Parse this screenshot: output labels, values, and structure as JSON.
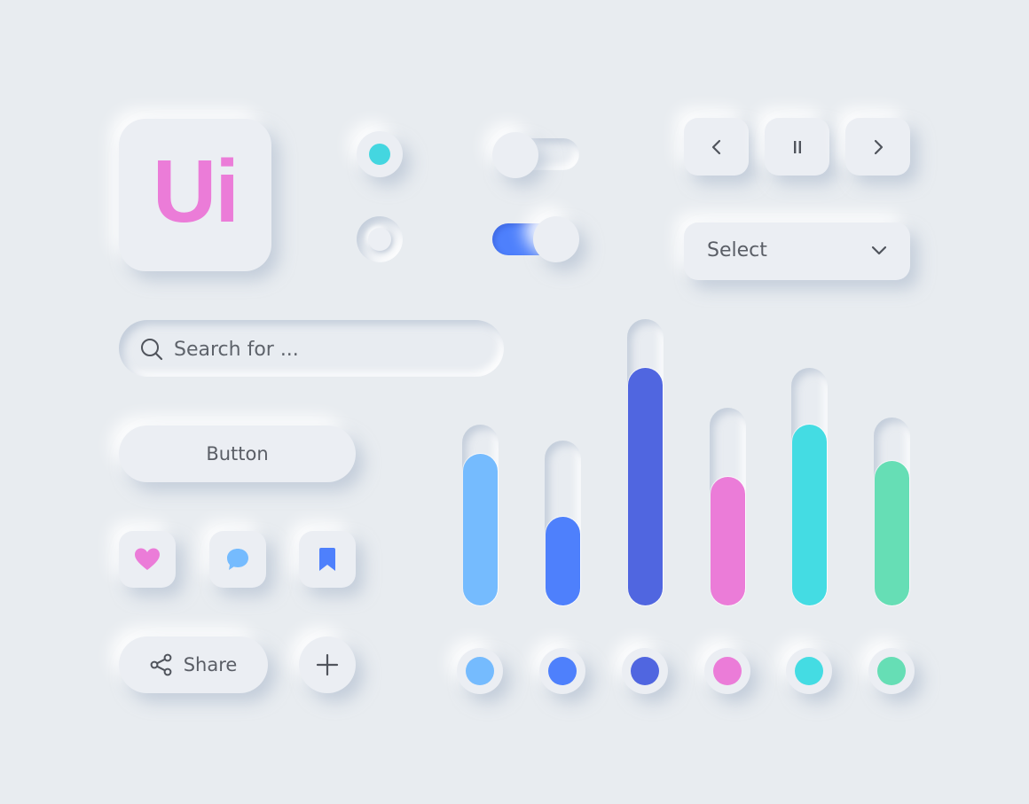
{
  "logo": {
    "text": "Ui",
    "color": "#EB7CD8"
  },
  "radios": [
    {
      "name": "radio-selected",
      "checked": true,
      "accent": "#44D6E0"
    },
    {
      "name": "radio-unselected",
      "checked": false
    }
  ],
  "toggles": [
    {
      "name": "toggle-off",
      "on": false
    },
    {
      "name": "toggle-on",
      "on": true,
      "accent": "#4E80FC"
    }
  ],
  "media": {
    "prev_icon": "chevron-left-icon",
    "pause_icon": "pause-icon",
    "next_icon": "chevron-right-icon"
  },
  "select": {
    "label": "Select",
    "icon": "chevron-down-icon"
  },
  "search": {
    "placeholder": "Search for ...",
    "value": "",
    "icon": "search-icon"
  },
  "button": {
    "label": "Button"
  },
  "icon_buttons": [
    {
      "name": "like",
      "icon": "heart-icon",
      "color": "#EB7CD8"
    },
    {
      "name": "comment",
      "icon": "chat-bubble-icon",
      "color": "#75BBFE"
    },
    {
      "name": "bookmark",
      "icon": "bookmark-icon",
      "color": "#4E80FC"
    }
  ],
  "share": {
    "label": "Share",
    "icon": "share-icon"
  },
  "add": {
    "icon": "plus-icon"
  },
  "sliders": [
    {
      "name": "slider-light-blue",
      "value": 0.84,
      "color": "#75BBFE"
    },
    {
      "name": "slider-blue",
      "value": 0.54,
      "color": "#4E80FC"
    },
    {
      "name": "slider-indigo",
      "value": 0.83,
      "color": "#5066E0"
    },
    {
      "name": "slider-pink",
      "value": 0.65,
      "color": "#EB7CD8"
    },
    {
      "name": "slider-cyan",
      "value": 0.76,
      "color": "#44DCE3"
    },
    {
      "name": "slider-green",
      "value": 0.77,
      "color": "#66DEB5"
    }
  ],
  "swatches": [
    {
      "name": "swatch-light-blue",
      "color": "#75BBFE"
    },
    {
      "name": "swatch-blue",
      "color": "#4E80FC"
    },
    {
      "name": "swatch-indigo",
      "color": "#5066E0"
    },
    {
      "name": "swatch-pink",
      "color": "#EB7CD8"
    },
    {
      "name": "swatch-cyan",
      "color": "#44DCE3"
    },
    {
      "name": "swatch-green",
      "color": "#66DEB5"
    }
  ]
}
